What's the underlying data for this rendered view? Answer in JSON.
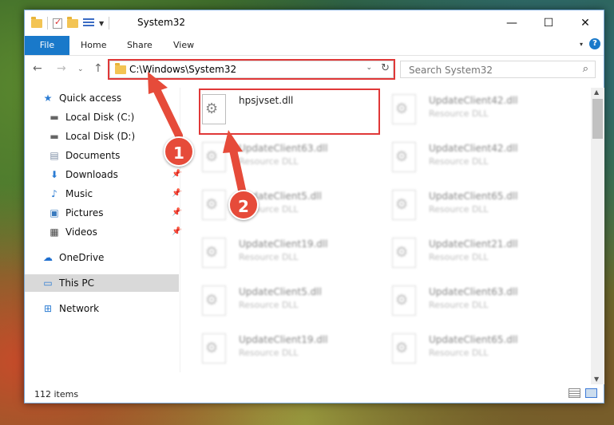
{
  "window": {
    "title": "System32",
    "controls": {
      "minimize": "—",
      "maximize": "☐",
      "close": "✕"
    }
  },
  "ribbon": {
    "tabs": [
      "File",
      "Home",
      "Share",
      "View"
    ]
  },
  "address": {
    "path": "C:\\Windows\\System32",
    "search_placeholder": "Search System32"
  },
  "sidebar": {
    "items": [
      {
        "label": "Quick access",
        "icon": "star-icon",
        "pinned": false
      },
      {
        "label": "Local Disk (C:)",
        "icon": "drive-icon",
        "pinned": false
      },
      {
        "label": "Local Disk (D:)",
        "icon": "drive-icon",
        "pinned": false
      },
      {
        "label": "Documents",
        "icon": "documents-icon",
        "pinned": true
      },
      {
        "label": "Downloads",
        "icon": "download-icon",
        "pinned": true
      },
      {
        "label": "Music",
        "icon": "music-icon",
        "pinned": true
      },
      {
        "label": "Pictures",
        "icon": "pictures-icon",
        "pinned": true
      },
      {
        "label": "Videos",
        "icon": "videos-icon",
        "pinned": true
      },
      {
        "label": "OneDrive",
        "icon": "cloud-icon",
        "pinned": false
      },
      {
        "label": "This PC",
        "icon": "computer-icon",
        "pinned": false,
        "selected": true
      },
      {
        "label": "Network",
        "icon": "network-icon",
        "pinned": false
      }
    ]
  },
  "files": [
    {
      "name": "hpsjvset.dll",
      "type": "",
      "selected": true
    },
    {
      "name": "UpdateClient42.dll",
      "type": "Resource DLL"
    },
    {
      "name": "UpdateClient63.dll",
      "type": "Resource DLL"
    },
    {
      "name": "UpdateClient42.dll",
      "type": "Resource DLL"
    },
    {
      "name": "UpdateClient5.dll",
      "type": "Resource DLL"
    },
    {
      "name": "UpdateClient65.dll",
      "type": "Resource DLL"
    },
    {
      "name": "UpdateClient19.dll",
      "type": "Resource DLL"
    },
    {
      "name": "UpdateClient21.dll",
      "type": "Resource DLL"
    },
    {
      "name": "UpdateClient5.dll",
      "type": "Resource DLL"
    },
    {
      "name": "UpdateClient63.dll",
      "type": "Resource DLL"
    },
    {
      "name": "UpdateClient19.dll",
      "type": "Resource DLL"
    },
    {
      "name": "UpdateClient65.dll",
      "type": "Resource DLL"
    }
  ],
  "status": {
    "item_count": "112 items"
  },
  "annotations": {
    "step1": "1",
    "step2": "2"
  },
  "colors": {
    "accent": "#1979ca",
    "highlight": "#e03838",
    "callout": "#e64b3a"
  }
}
